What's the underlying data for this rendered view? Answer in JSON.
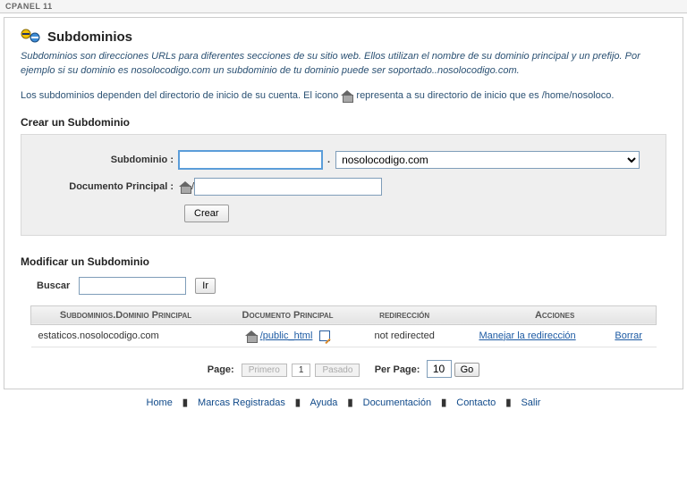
{
  "titlebar": "CPANEL 11",
  "header": {
    "title": "Subdominios"
  },
  "intro": {
    "p1": "Subdominios son direcciones URLs para diferentes secciones de su sitio web. Ellos utilizan el nombre de su dominio principal y un prefijo. Por ejemplo si su dominio es nosolocodigo.com un subdominio de tu dominio puede ser soportado..nosolocodigo.com.",
    "p2a": "Los subdominios dependen del directorio de inicio de su cuenta. El icono ",
    "p2b": " representa a su directorio de inicio que es ",
    "home_path": "/home/nosoloco",
    "dot": "."
  },
  "create": {
    "heading": "Crear un Subdominio",
    "subdomain_label": "Subdominio :",
    "subdomain_value": "",
    "dot": ".",
    "domain_options": [
      "nosolocodigo.com"
    ],
    "domain_selected": "nosolocodigo.com",
    "docroot_label": "Documento Principal :",
    "docroot_prefix": "/",
    "docroot_value": "",
    "submit": "Crear"
  },
  "modify": {
    "heading": "Modificar un Subdominio",
    "search_label": "Buscar",
    "search_value": "",
    "go_label": "Ir",
    "columns": {
      "c1": "Subdominios.Dominio Principal",
      "c2": "Documento Principal",
      "c3": "redirección",
      "c4": "Acciones"
    },
    "rows": [
      {
        "domain": "estaticos.nosolocodigo.com",
        "docroot": "/public_html",
        "redirection": "not redirected",
        "action_manage": "Manejar la redirección",
        "action_delete": "Borrar"
      }
    ]
  },
  "pager": {
    "page_label": "Page:",
    "first": "Primero",
    "current": "1",
    "passed": "Pasado",
    "perpage_label": "Per Page:",
    "perpage_value": "10",
    "go": "Go"
  },
  "footer": {
    "links": [
      "Home",
      "Marcas Registradas",
      "Ayuda",
      "Documentación",
      "Contacto",
      "Salir"
    ]
  }
}
